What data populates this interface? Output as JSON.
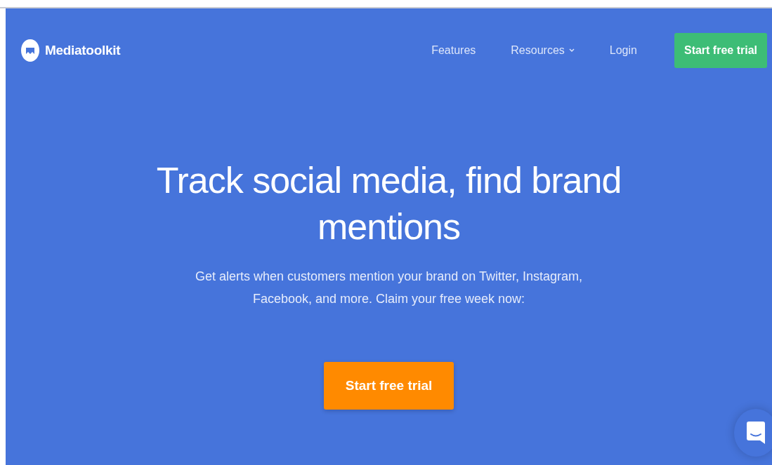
{
  "header": {
    "logo": "Mediatoolkit",
    "nav": [
      {
        "label": "Features",
        "kind": "link"
      },
      {
        "label": "Resources",
        "kind": "dropdown"
      },
      {
        "label": "Login",
        "kind": "link"
      }
    ],
    "cta": "Start free trial"
  },
  "hero": {
    "title": "Track social media, find brand mentions",
    "subtitle": "Get alerts when customers mention your brand on Twitter, Instagram, Facebook, and more. Claim your free week now:",
    "cta": "Start free trial"
  }
}
